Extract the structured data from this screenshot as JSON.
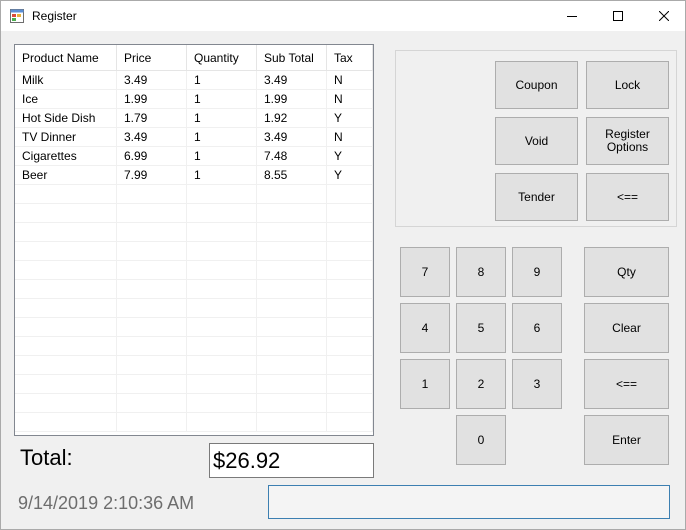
{
  "window": {
    "title": "Register"
  },
  "grid": {
    "columns": [
      "Product Name",
      "Price",
      "Quantity",
      "Sub Total",
      "Tax"
    ],
    "rows": [
      [
        "Milk",
        "3.49",
        "1",
        "3.49",
        "N"
      ],
      [
        "Ice",
        "1.99",
        "1",
        "1.99",
        "N"
      ],
      [
        "Hot Side Dish",
        "1.79",
        "1",
        "1.92",
        "Y"
      ],
      [
        "TV Dinner",
        "3.49",
        "1",
        "3.49",
        "N"
      ],
      [
        "Cigarettes",
        "6.99",
        "1",
        "7.48",
        "Y"
      ],
      [
        "Beer",
        "7.99",
        "1",
        "8.55",
        "Y"
      ]
    ]
  },
  "total": {
    "label": "Total:",
    "value": "$26.92"
  },
  "datetime": "9/14/2019 2:10:36 AM",
  "entry": {
    "value": ""
  },
  "actions": {
    "coupon": "Coupon",
    "lock": "Lock",
    "void": "Void",
    "register_options": "Register Options",
    "tender": "Tender",
    "backspace": "<=="
  },
  "keypad": {
    "k7": "7",
    "k8": "8",
    "k9": "9",
    "k4": "4",
    "k5": "5",
    "k6": "6",
    "k1": "1",
    "k2": "2",
    "k3": "3",
    "k0": "0",
    "qty": "Qty",
    "clear": "Clear",
    "backspace": "<==",
    "enter": "Enter"
  }
}
